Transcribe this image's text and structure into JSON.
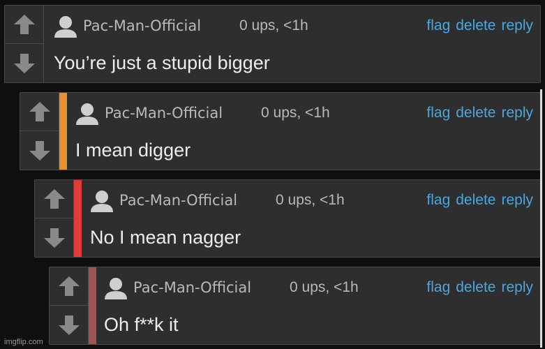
{
  "comments": [
    {
      "username": "Pac-Man-Official",
      "meta": "0 ups, <1h",
      "body": "You’re just a stupid bigger",
      "stripe_color": "",
      "actions": {
        "flag": "flag",
        "delete": "delete",
        "reply": "reply"
      }
    },
    {
      "username": "Pac-Man-Official",
      "meta": "0 ups, <1h",
      "body": "I mean digger",
      "stripe_color": "#e8902e",
      "actions": {
        "flag": "flag",
        "delete": "delete",
        "reply": "reply"
      }
    },
    {
      "username": "Pac-Man-Official",
      "meta": "0 ups, <1h",
      "body": "No I mean nagger",
      "stripe_color": "#e23b3b",
      "actions": {
        "flag": "flag",
        "delete": "delete",
        "reply": "reply"
      }
    },
    {
      "username": "Pac-Man-Official",
      "meta": "0 ups, <1h",
      "body": "Oh f**k it",
      "stripe_color": "#9e5454",
      "actions": {
        "flag": "flag",
        "delete": "delete",
        "reply": "reply"
      }
    }
  ],
  "icons": {
    "upvote": "arrow-up-icon",
    "downvote": "arrow-down-icon",
    "avatar": "user-avatar-icon"
  },
  "colors": {
    "link": "#4aa8e0",
    "text_muted": "#b9b9b9",
    "text_main": "#ededed",
    "panel": "#2e2e2e",
    "background": "#0f0f0f"
  },
  "watermark": "imgflip.com"
}
